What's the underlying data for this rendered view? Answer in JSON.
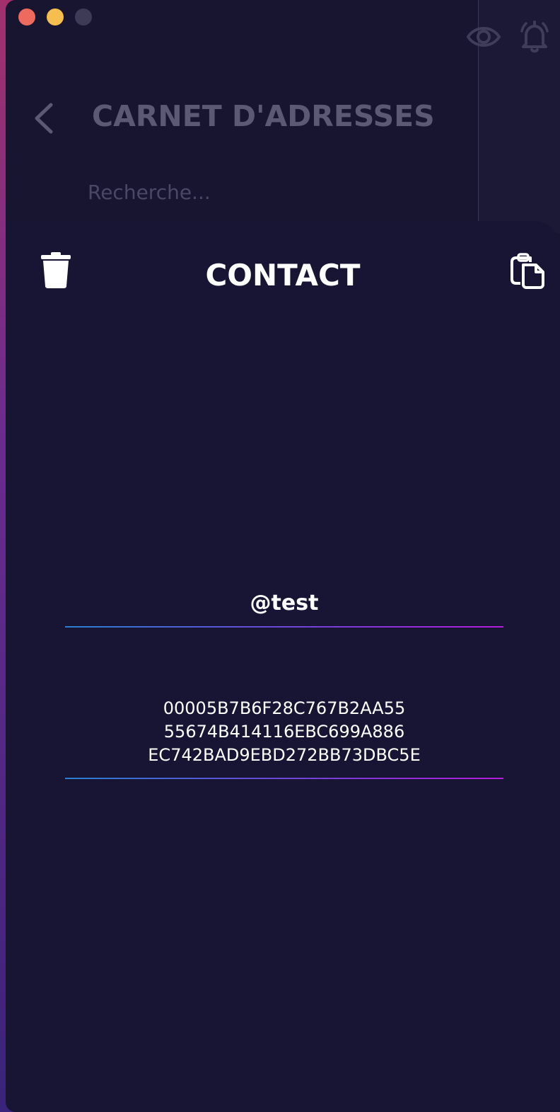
{
  "window": {
    "controls": [
      "close",
      "minimize",
      "zoom"
    ]
  },
  "background_page": {
    "title": "CARNET D'ADRESSES",
    "search_placeholder": "Recherche..."
  },
  "modal": {
    "title": "CONTACT",
    "icons": {
      "delete": "trash-icon",
      "copy": "clipboard-icon"
    },
    "contact_name": "@test",
    "contact_key_lines": [
      "00005B7B6F28C767B2AA55",
      "55674B414116EBC699A886",
      "EC742BAD9EBD272BB73DBC5E"
    ]
  },
  "colors": {
    "background": "#181534",
    "underline_start": "#2a7fd0",
    "underline_end": "#b21ddc",
    "text": "#ffffff"
  }
}
